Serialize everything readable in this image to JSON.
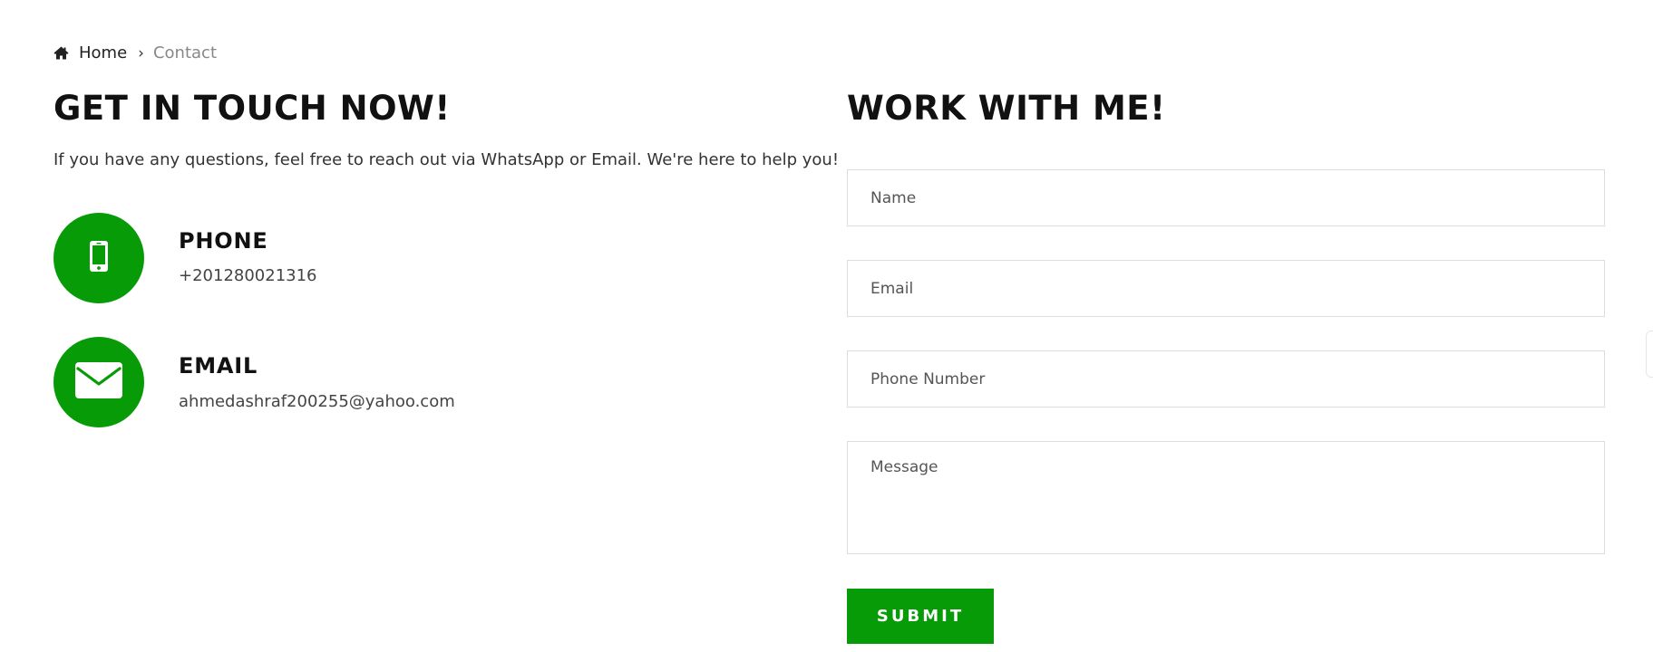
{
  "breadcrumb": {
    "home_label": "Home",
    "separator": "›",
    "current": "Contact"
  },
  "left": {
    "heading": "GET IN TOUCH NOW!",
    "intro": "If you have any questions, feel free to reach out via WhatsApp or Email. We're here to help you!",
    "phone": {
      "label": "PHONE",
      "value": "+201280021316",
      "icon": "mobile-phone-icon"
    },
    "email": {
      "label": "EMAIL",
      "value": "ahmedashraf200255@yahoo.com",
      "icon": "envelope-icon"
    }
  },
  "form": {
    "heading": "WORK WITH ME!",
    "name_placeholder": "Name",
    "email_placeholder": "Email",
    "phone_placeholder": "Phone Number",
    "message_placeholder": "Message",
    "submit_label": "SUBMIT"
  },
  "colors": {
    "accent": "#079b07",
    "heading": "#111111",
    "muted": "#888888",
    "border": "#dddddd"
  }
}
